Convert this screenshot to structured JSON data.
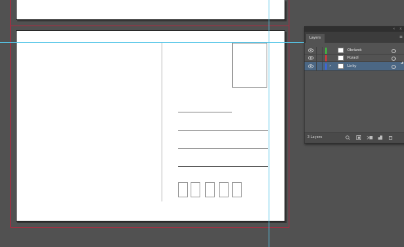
{
  "panel": {
    "title_buttons": {
      "collapse": "«",
      "close": "×"
    },
    "tab_label": "Layers",
    "menu_icon": "panel-menu-icon",
    "layers": [
      {
        "name": "Obrázek",
        "color": "#3fc73f",
        "selected": false,
        "visible": true,
        "expanded": false
      },
      {
        "name": "Pozadí",
        "color": "#e23838",
        "selected": false,
        "visible": true,
        "expanded": false
      },
      {
        "name": "Linky",
        "color": "#3a66e8",
        "selected": true,
        "visible": true,
        "expanded": false
      }
    ],
    "footer": {
      "layer_count": "3 Layers",
      "icons": [
        "locate-object-icon",
        "make-clipping-mask-icon",
        "create-sublayer-icon",
        "create-new-layer-icon",
        "delete-layer-icon"
      ]
    }
  },
  "canvas": {
    "guide_color": "#57c6e8",
    "bleed_color": "#b3273f",
    "artboard_color": "#ffffff",
    "pasteboard_color": "#515151"
  }
}
